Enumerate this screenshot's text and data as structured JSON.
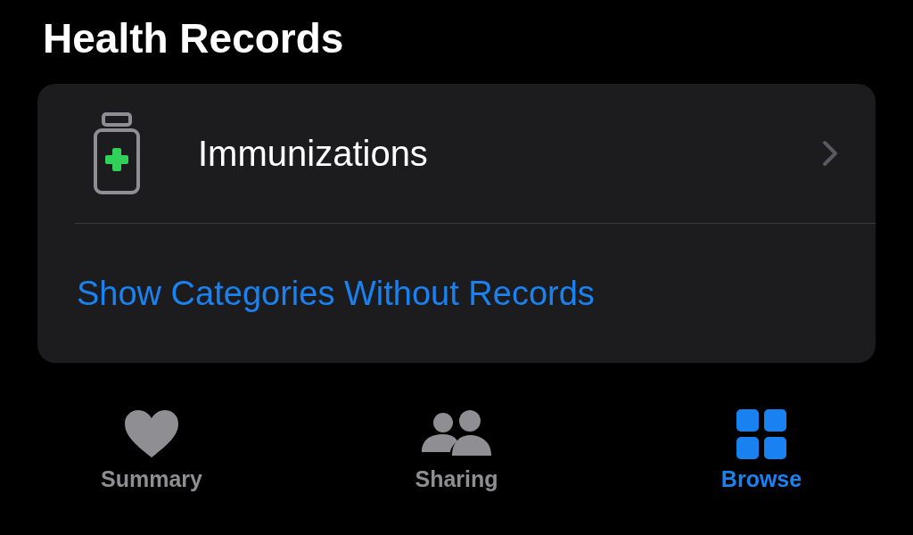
{
  "title": "Health Records",
  "records": [
    {
      "label": "Immunizations",
      "kind": "immunizations"
    }
  ],
  "link": "Show Categories Without Records",
  "tabs": [
    {
      "label": "Summary",
      "kind": "heart",
      "selected": false
    },
    {
      "label": "Sharing",
      "kind": "people",
      "selected": false
    },
    {
      "label": "Browse",
      "kind": "grid",
      "selected": true
    }
  ]
}
